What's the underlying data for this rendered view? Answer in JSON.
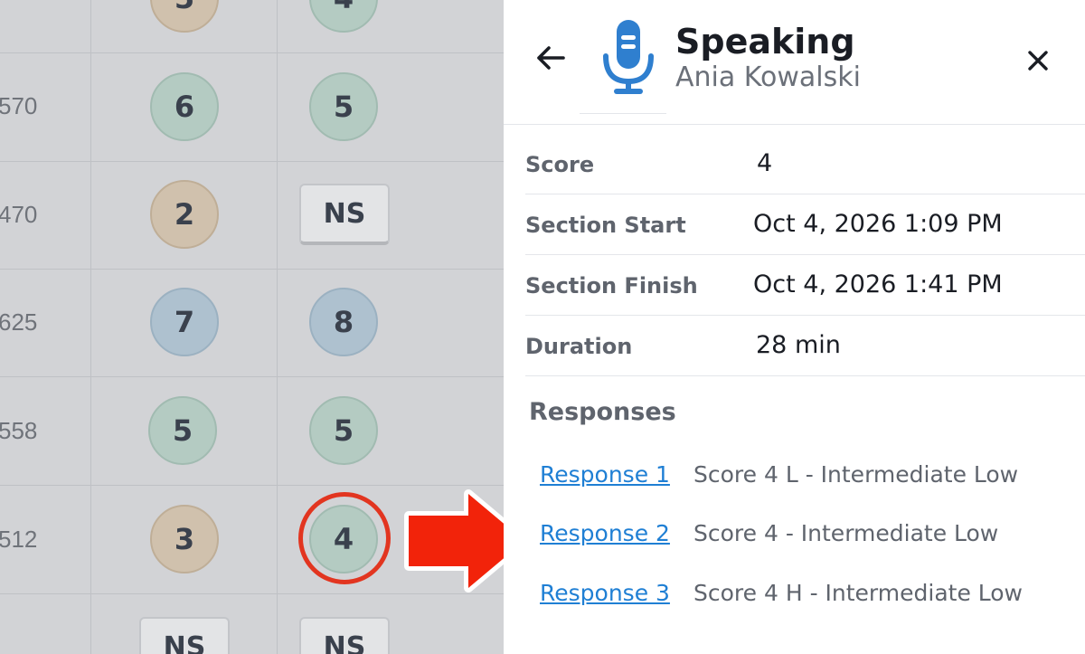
{
  "table": {
    "top_partial": {
      "col1": "5",
      "col2": "4"
    },
    "rows": [
      {
        "id": "570",
        "col1": "6",
        "col2": "5"
      },
      {
        "id": "470",
        "col1": "2",
        "col2": "NS"
      },
      {
        "id": "625",
        "col1": "7",
        "col2": "8"
      },
      {
        "id": "558",
        "col1": "5",
        "col2": "5"
      },
      {
        "id": "512",
        "col1": "3",
        "col2": "4"
      }
    ],
    "bottom_partial": {
      "col1": "NS",
      "col2": "NS"
    }
  },
  "panel": {
    "title": "Speaking",
    "subtitle": "Ania Kowalski",
    "back_icon": "arrow-left-icon",
    "close_icon": "close-icon",
    "section_icon": "microphone-icon",
    "info": [
      {
        "label": "Score",
        "value": "4"
      },
      {
        "label": "Section Start",
        "value": "Oct 4, 2026 1:09 PM"
      },
      {
        "label": "Section Finish",
        "value": "Oct 4, 2026 1:41 PM"
      },
      {
        "label": "Duration",
        "value": "28 min"
      }
    ],
    "responses_title": "Responses",
    "responses": [
      {
        "link": "Response 1",
        "score": "Score 4 L - Intermediate Low"
      },
      {
        "link": "Response 2",
        "score": "Score 4 - Intermediate Low"
      },
      {
        "link": "Response 3",
        "score": "Score 4 H - Intermediate Low"
      }
    ]
  },
  "colors": {
    "link": "#1f7fd4",
    "mic": "#2f7fcf",
    "highlight": "#e23520",
    "dim_background": "#d2d3d6"
  }
}
